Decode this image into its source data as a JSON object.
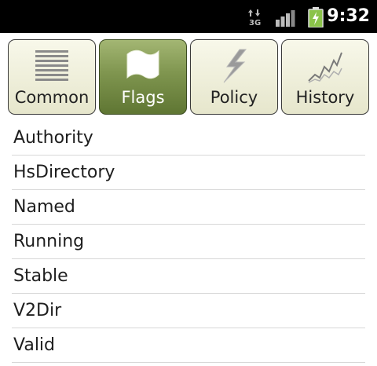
{
  "status_bar": {
    "network_type": "3G",
    "time": "9:32"
  },
  "tabs": [
    {
      "label": "Common",
      "icon": "list-lines-icon",
      "active": false
    },
    {
      "label": "Flags",
      "icon": "flag-icon",
      "active": true
    },
    {
      "label": "Policy",
      "icon": "lightning-icon",
      "active": false
    },
    {
      "label": "History",
      "icon": "line-chart-icon",
      "active": false
    }
  ],
  "flags": [
    "Authority",
    "HsDirectory",
    "Named",
    "Running",
    "Stable",
    "V2Dir",
    "Valid"
  ],
  "colors": {
    "active_tab": "#7f954f",
    "inactive_tab": "#f0f0dc",
    "status_bar": "#000000",
    "battery": "#8bc34a"
  }
}
